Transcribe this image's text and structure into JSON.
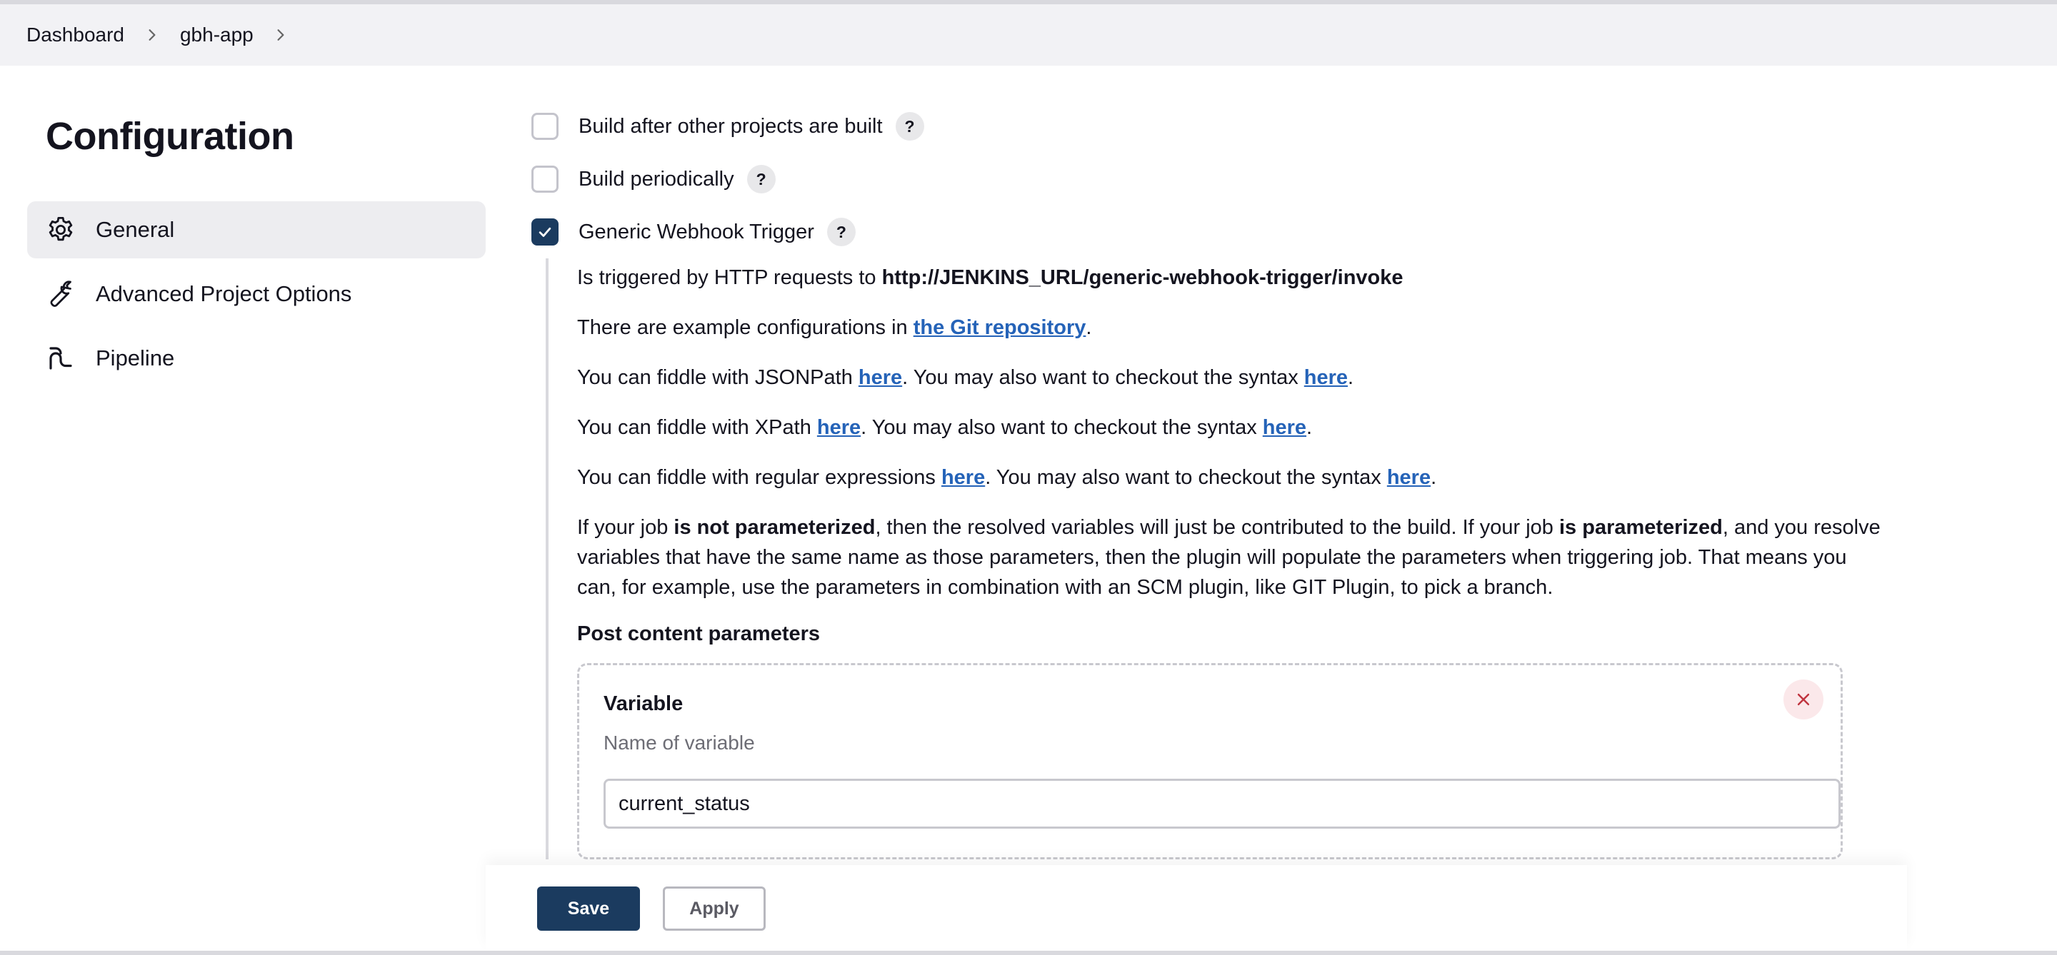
{
  "breadcrumb": {
    "items": [
      "Dashboard",
      "gbh-app"
    ]
  },
  "sidebar": {
    "title": "Configuration",
    "items": [
      {
        "label": "General",
        "icon": "gear-icon",
        "active": true
      },
      {
        "label": "Advanced Project Options",
        "icon": "wrench-icon",
        "active": false
      },
      {
        "label": "Pipeline",
        "icon": "pipeline-icon",
        "active": false
      }
    ]
  },
  "triggers": {
    "items": [
      {
        "label": "Build after other projects are built",
        "checked": false
      },
      {
        "label": "Build periodically",
        "checked": false
      },
      {
        "label": "Generic Webhook Trigger",
        "checked": true
      }
    ],
    "help_label": "?"
  },
  "webhook": {
    "p1_text": "Is triggered by HTTP requests to ",
    "p1_url": "http://JENKINS_URL/generic-webhook-trigger/invoke",
    "p2_text": "There are example configurations in ",
    "p2_link": "the Git repository",
    "p2_end": ".",
    "p3_text": "You can fiddle with JSONPath ",
    "p3_link1": "here",
    "p3_mid": ". You may also want to checkout the syntax ",
    "p3_link2": "here",
    "p3_end": ".",
    "p4_text": "You can fiddle with XPath ",
    "p4_link1": "here",
    "p4_mid": ". You may also want to checkout the syntax ",
    "p4_link2": "here",
    "p4_end": ".",
    "p5_text": "You can fiddle with regular expressions ",
    "p5_link1": "here",
    "p5_mid": ". You may also want to checkout the syntax ",
    "p5_link2": "here",
    "p5_end": ".",
    "p6_a": "If your job ",
    "p6_b": "is not parameterized",
    "p6_c": ", then the resolved variables will just be contributed to the build. If your job ",
    "p6_d": "is parameterized",
    "p6_e": ", and you resolve variables that have the same name as those parameters, then the plugin will populate the parameters when triggering job. That means you can, for example, use the parameters in combination with an SCM plugin, like GIT Plugin, to pick a branch.",
    "post_content_label": "Post content parameters",
    "variable_label": "Variable",
    "variable_sub": "Name of variable",
    "variable_value": "current_status"
  },
  "actions": {
    "save_label": "Save",
    "apply_label": "Apply"
  },
  "colors": {
    "accent": "#1b3b5f",
    "link": "#2563b8",
    "close_bg": "#fbe8ea",
    "close_x": "#c0343f"
  }
}
